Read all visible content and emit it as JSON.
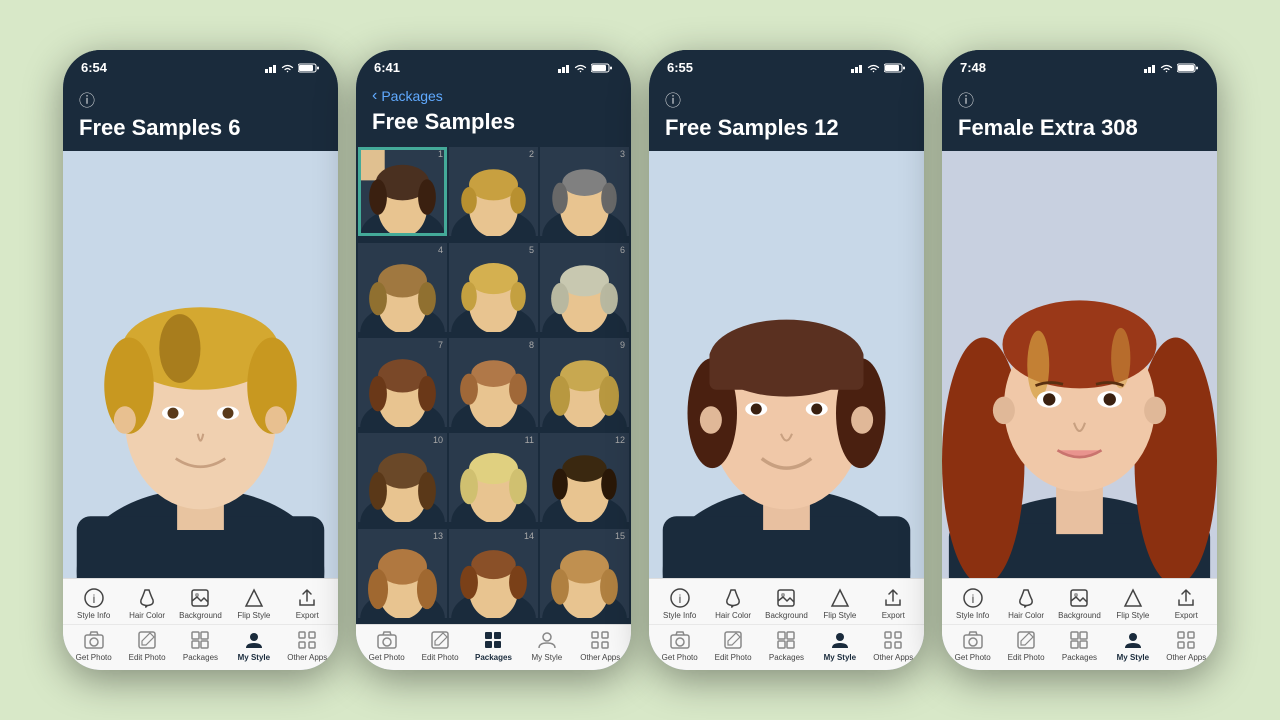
{
  "background": "#d8e8c8",
  "phones": [
    {
      "id": "phone1",
      "time": "6:54",
      "header": {
        "title": "Free Samples 6",
        "has_info": true,
        "has_back": false
      },
      "content_type": "portrait",
      "toolbar": {
        "top_items": [
          {
            "id": "style-info",
            "label": "Style Info",
            "icon": "info"
          },
          {
            "id": "hair-color",
            "label": "Hair Color",
            "icon": "bucket"
          },
          {
            "id": "background",
            "label": "Background",
            "icon": "photo"
          },
          {
            "id": "flip-style",
            "label": "Flip Style",
            "icon": "triangle"
          },
          {
            "id": "export",
            "label": "Export",
            "icon": "share"
          }
        ],
        "bottom_items": [
          {
            "id": "get-photo",
            "label": "Get Photo",
            "icon": "camera"
          },
          {
            "id": "edit-photo",
            "label": "Edit Photo",
            "icon": "edit"
          },
          {
            "id": "packages",
            "label": "Packages",
            "icon": "grid"
          },
          {
            "id": "my-style",
            "label": "My Style",
            "icon": "person",
            "active": true
          },
          {
            "id": "other-apps",
            "label": "Other Apps",
            "icon": "apps"
          }
        ]
      }
    },
    {
      "id": "phone2",
      "time": "6:41",
      "header": {
        "title": "Free Samples",
        "has_info": false,
        "has_back": true,
        "back_label": "Packages"
      },
      "content_type": "grid",
      "grid_items": [
        {
          "num": 1,
          "selected": true
        },
        {
          "num": 2,
          "selected": false
        },
        {
          "num": 3,
          "selected": false
        },
        {
          "num": 4,
          "selected": false
        },
        {
          "num": 5,
          "selected": false
        },
        {
          "num": 6,
          "selected": false
        },
        {
          "num": 7,
          "selected": false
        },
        {
          "num": 8,
          "selected": false
        },
        {
          "num": 9,
          "selected": false
        },
        {
          "num": 10,
          "selected": false
        },
        {
          "num": 11,
          "selected": false
        },
        {
          "num": 12,
          "selected": false
        },
        {
          "num": 13,
          "selected": false
        },
        {
          "num": 14,
          "selected": false
        },
        {
          "num": 15,
          "selected": false
        }
      ],
      "toolbar": {
        "top_items": [],
        "bottom_items": [
          {
            "id": "get-photo",
            "label": "Get Photo",
            "icon": "camera"
          },
          {
            "id": "edit-photo",
            "label": "Edit Photo",
            "icon": "edit"
          },
          {
            "id": "packages",
            "label": "Packages",
            "icon": "grid",
            "active": true
          },
          {
            "id": "my-style",
            "label": "My Style",
            "icon": "person"
          },
          {
            "id": "other-apps",
            "label": "Other Apps",
            "icon": "apps"
          }
        ]
      }
    },
    {
      "id": "phone3",
      "time": "6:55",
      "header": {
        "title": "Free Samples 12",
        "has_info": true,
        "has_back": false
      },
      "content_type": "portrait",
      "toolbar": {
        "top_items": [
          {
            "id": "style-info",
            "label": "Style Info",
            "icon": "info"
          },
          {
            "id": "hair-color",
            "label": "Hair Color",
            "icon": "bucket"
          },
          {
            "id": "background",
            "label": "Background",
            "icon": "photo"
          },
          {
            "id": "flip-style",
            "label": "Flip Style",
            "icon": "triangle"
          },
          {
            "id": "export",
            "label": "Export",
            "icon": "share"
          }
        ],
        "bottom_items": [
          {
            "id": "get-photo",
            "label": "Get Photo",
            "icon": "camera"
          },
          {
            "id": "edit-photo",
            "label": "Edit Photo",
            "icon": "edit"
          },
          {
            "id": "packages",
            "label": "Packages",
            "icon": "grid"
          },
          {
            "id": "my-style",
            "label": "My Style",
            "icon": "person",
            "active": true
          },
          {
            "id": "other-apps",
            "label": "Other Apps",
            "icon": "apps"
          }
        ]
      }
    },
    {
      "id": "phone4",
      "time": "7:48",
      "header": {
        "title": "Female Extra 308",
        "has_info": true,
        "has_back": false
      },
      "content_type": "portrait",
      "toolbar": {
        "top_items": [
          {
            "id": "style-info",
            "label": "Style Info",
            "icon": "info"
          },
          {
            "id": "hair-color",
            "label": "Hair Color",
            "icon": "bucket"
          },
          {
            "id": "background",
            "label": "Background",
            "icon": "photo"
          },
          {
            "id": "flip-style",
            "label": "Flip Style",
            "icon": "triangle"
          },
          {
            "id": "export",
            "label": "Export",
            "icon": "share"
          }
        ],
        "bottom_items": [
          {
            "id": "get-photo",
            "label": "Get Photo",
            "icon": "camera"
          },
          {
            "id": "edit-photo",
            "label": "Edit Photo",
            "icon": "edit"
          },
          {
            "id": "packages",
            "label": "Packages",
            "icon": "grid"
          },
          {
            "id": "my-style",
            "label": "My Style",
            "icon": "person",
            "active": true
          },
          {
            "id": "other-apps",
            "label": "Other Apps",
            "icon": "apps"
          }
        ]
      }
    }
  ]
}
